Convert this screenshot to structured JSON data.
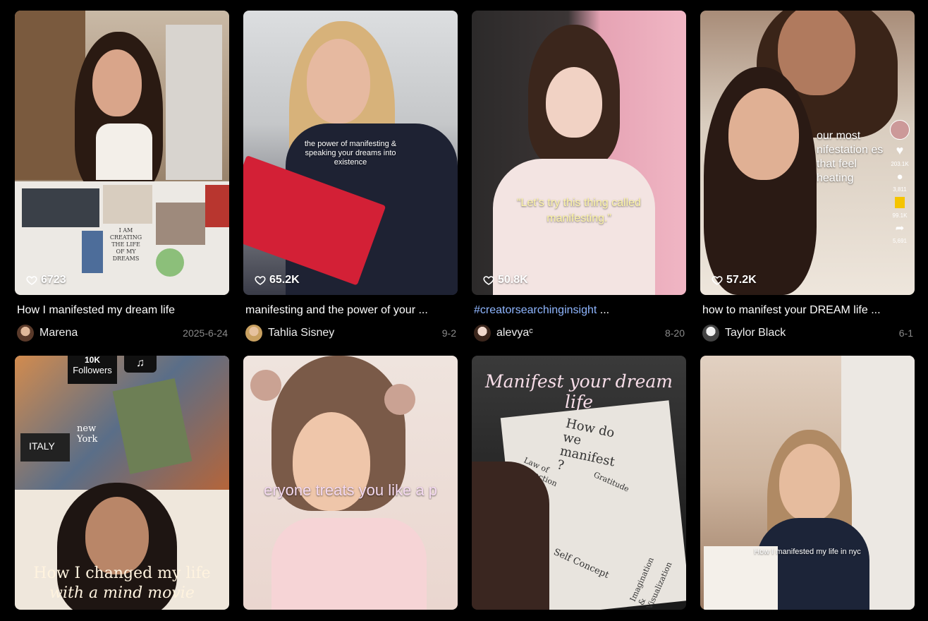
{
  "videos": [
    {
      "likes": "6723",
      "caption": "How I manifested my dream life",
      "author": "Marena",
      "date": "2025-6-24",
      "overlay": "",
      "board_text": "I AM CREATING THE LIFE OF MY DREAMS"
    },
    {
      "likes": "65.2K",
      "caption": "manifesting and the power of your ...",
      "author": "Tahlia Sisney",
      "date": "9-2",
      "overlay": "the power of manifesting & speaking your dreams into existence"
    },
    {
      "likes": "50.8K",
      "caption_tag": "#creatorsearchinginsight",
      "caption_rest": " ...",
      "author": "alevyaᶜ",
      "date": "8-20",
      "overlay": "“Let’s try this thing called manifesting.”"
    },
    {
      "likes": "57.2K",
      "caption": "how to manifest your DREAM life ...",
      "author": "Taylor Black",
      "date": "6-1",
      "overlay": "our most nifestation es that feel heating",
      "side": {
        "likes": "203.1K",
        "comments": "3,811",
        "saves": "99.1K",
        "shares": "5,691"
      }
    },
    {
      "overlay_top": "10K",
      "overlay_followers": "Followers",
      "city_italy": "ITALY",
      "city_ny": "new York",
      "title_line1": "How I changed my life",
      "title_line2": "with a mind movie"
    },
    {
      "overlay": "eryone treats you like a p"
    },
    {
      "title": "Manifest your dream life",
      "book_heading": "How do we manifest ?",
      "book_terms": [
        "Law of Attraction",
        "Gratitude",
        "Self Concept",
        "Imagination & Visualization"
      ]
    },
    {
      "overlay": "How I manifested my life in nyc"
    }
  ],
  "colors": {
    "background": "#000000",
    "hashtag": "#8fb6ff",
    "date": "#8a8a8a"
  }
}
